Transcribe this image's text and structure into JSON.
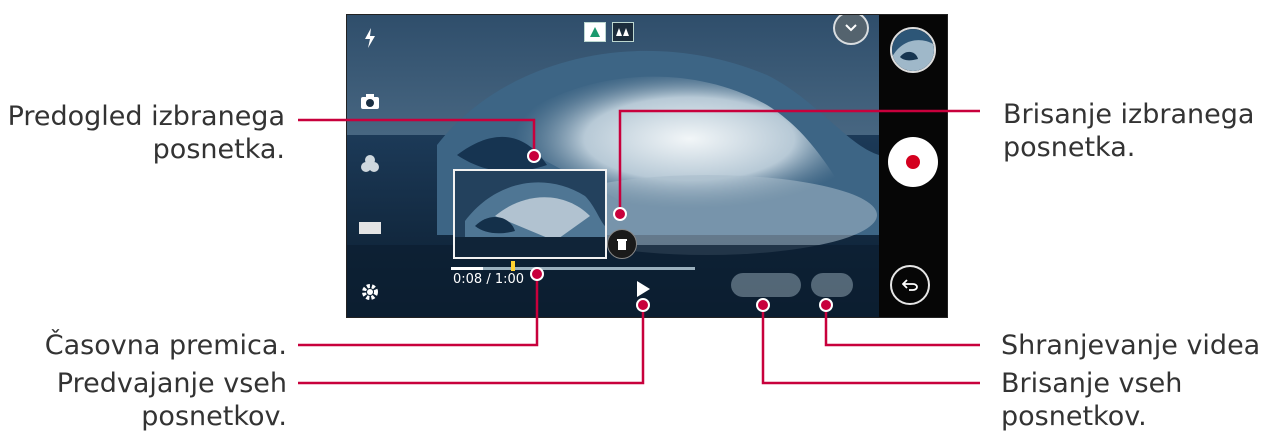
{
  "callouts": {
    "predogled": [
      "Predogled izbranega",
      "posnetka."
    ],
    "brisanje_izbranega": [
      "Brisanje izbranega",
      "posnetka."
    ],
    "casovna": [
      "Časovna premica."
    ],
    "predvajanje": [
      "Predvajanje vseh",
      "posnetkov."
    ],
    "shranjevanje": [
      "Shranjevanje videa."
    ],
    "brisanje_vseh": [
      "Brisanje vseh",
      "posnetkov."
    ]
  },
  "screen": {
    "timeline": {
      "time_text": "0:08 / 1:00",
      "progress": 0.133
    },
    "left_icons": [
      "flash-icon",
      "camera-icon",
      "filter-icon",
      "aspect-ratio-icon",
      "settings-icon"
    ],
    "mode_icons": [
      "single-view-icon",
      "multi-view-icon"
    ],
    "colors": {
      "record": "#d4001f",
      "callout_line": "#c8003c",
      "marker": "#ffd230"
    }
  }
}
